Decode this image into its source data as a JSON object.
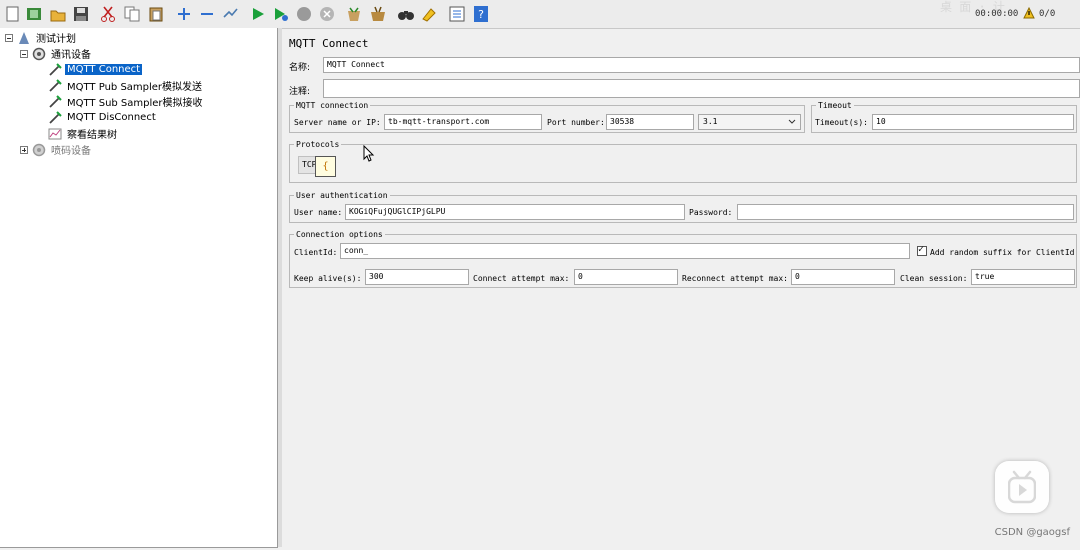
{
  "toolbar": {
    "icons": [
      "new-icon",
      "templates-icon",
      "open-icon",
      "save-icon",
      "cut-icon",
      "copy-icon",
      "paste-icon",
      "expand-icon",
      "collapse-icon",
      "toggle-icon",
      "start-icon",
      "start-no-pause-icon",
      "stop-icon",
      "shutdown-icon",
      "clear-icon",
      "clear-all-icon",
      "search-icon",
      "reset-search-icon",
      "function-helper-icon",
      "help-icon"
    ],
    "timer": "00:00:00",
    "counter": "0/0"
  },
  "tree": {
    "nodes": [
      {
        "label": "测试计划",
        "icon": "test-plan-icon"
      },
      {
        "label": "通讯设备",
        "icon": "thread-group-icon"
      },
      {
        "label": "MQTT Connect",
        "icon": "sampler-icon"
      },
      {
        "label": "MQTT Pub Sampler模拟发送",
        "icon": "sampler-icon"
      },
      {
        "label": "MQTT Sub Sampler模拟接收",
        "icon": "sampler-icon"
      },
      {
        "label": "MQTT DisConnect",
        "icon": "sampler-icon"
      },
      {
        "label": "察看结果树",
        "icon": "listener-icon"
      },
      {
        "label": "喷码设备",
        "icon": "thread-group-disabled-icon"
      }
    ]
  },
  "panel": {
    "title": "MQTT Connect",
    "name_label": "名称:",
    "name_value": "MQTT Connect",
    "comment_label": "注释:",
    "comment_value": "",
    "mqtt_connection": {
      "legend": "MQTT connection",
      "server_label": "Server name or IP:",
      "server_value": "tb-mqtt-transport.com",
      "port_label": "Port number:",
      "port_value": "30538",
      "version_value": "3.1"
    },
    "timeout": {
      "legend": "Timeout",
      "label": "Timeout(s):",
      "value": "10"
    },
    "protocols": {
      "legend": "Protocols",
      "value": "TCP",
      "popup": "{"
    },
    "auth": {
      "legend": "User authentication",
      "user_label": "User name:",
      "user_value": "KOGiQFujQUGlCIPjGLPU",
      "password_label": "Password:",
      "password_value": ""
    },
    "options": {
      "legend": "Connection options",
      "clientid_label": "ClientId:",
      "clientid_value": "conn_",
      "suffix_label": "Add random suffix for ClientId",
      "suffix_checked": true,
      "keepalive_label": "Keep alive(s):",
      "keepalive_value": "300",
      "attempt_label": "Connect attempt max:",
      "attempt_value": "0",
      "reconnect_label": "Reconnect attempt max:",
      "reconnect_value": "0",
      "clean_label": "Clean session:",
      "clean_value": "true"
    }
  },
  "watermark": "CSDN @gaogsf",
  "colors": {
    "selection": "#0a64c8",
    "run_green": "#1aa03a",
    "help_blue": "#2f6fd0"
  }
}
